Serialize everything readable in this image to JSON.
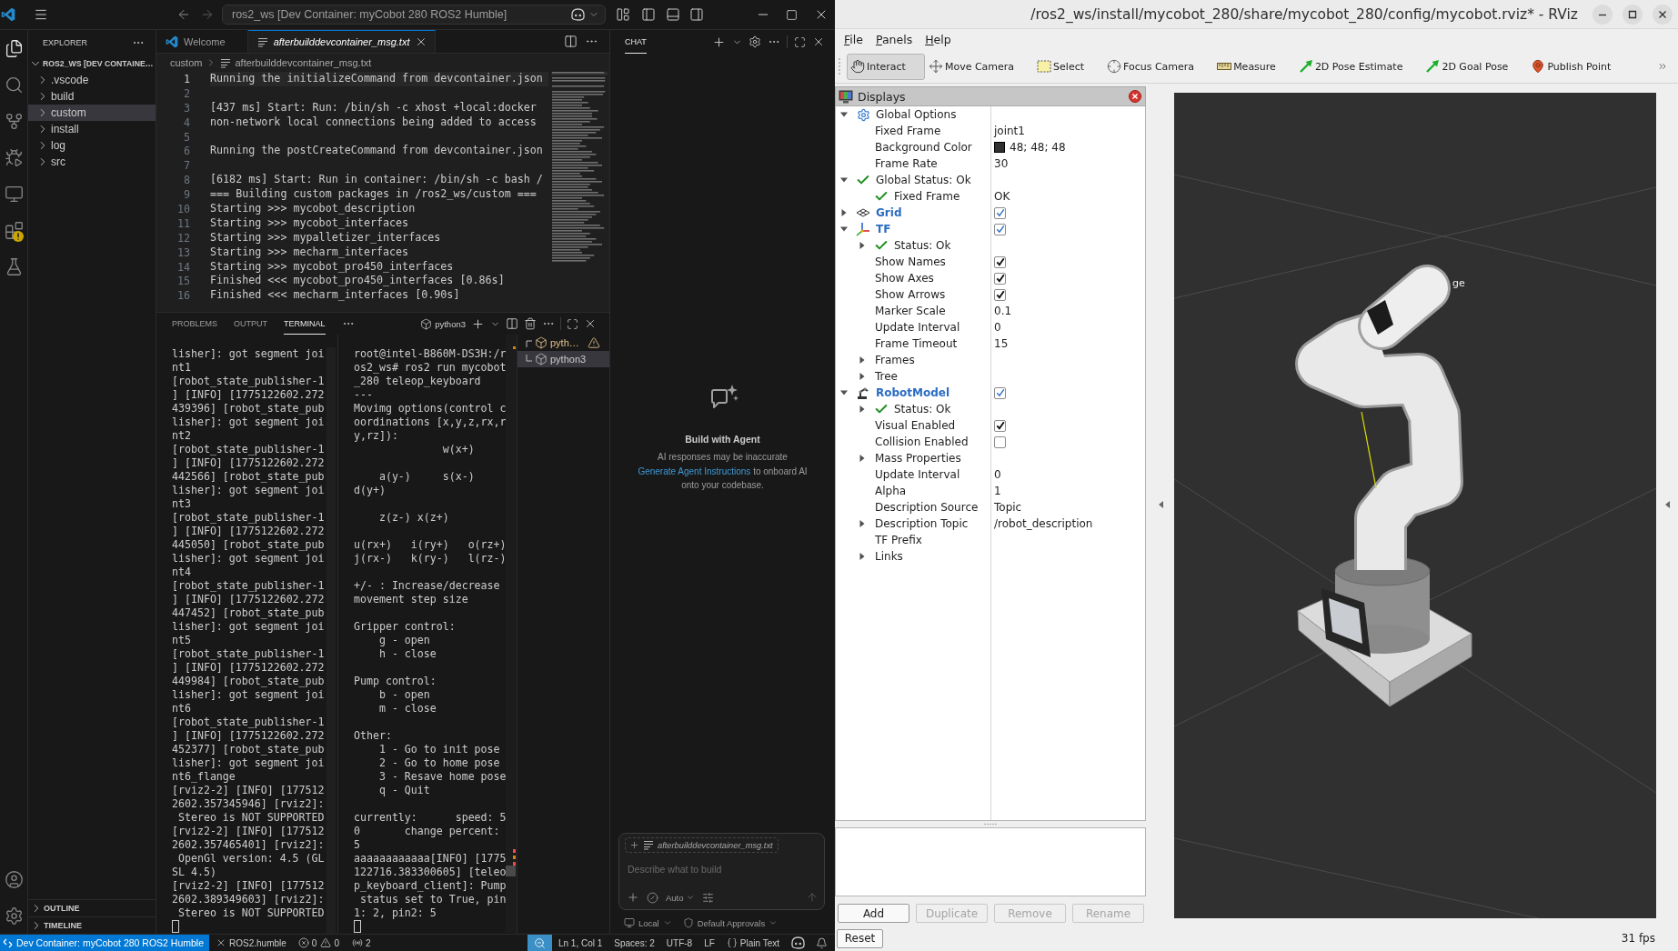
{
  "vscode": {
    "title_bar": {
      "command_center": "ros2_ws [Dev Container: myCobot 280 ROS2 Humble]"
    },
    "activity_bar": {
      "items": [
        {
          "kind": "explorer",
          "selected": true,
          "warning": false
        },
        {
          "kind": "search",
          "selected": false,
          "warning": false
        },
        {
          "kind": "source_control",
          "selected": false,
          "warning": false
        },
        {
          "kind": "run_debug",
          "selected": false,
          "warning": false
        },
        {
          "kind": "remote",
          "selected": false,
          "warning": false
        },
        {
          "kind": "extensions",
          "selected": false,
          "warning": true
        },
        {
          "kind": "testing",
          "selected": false,
          "warning": false
        }
      ],
      "bottom": [
        {
          "kind": "account"
        },
        {
          "kind": "manage"
        }
      ]
    },
    "explorer": {
      "title": "EXPLORER",
      "root": {
        "label": "ROS2_WS [DEV CONTAINE…",
        "expanded": true,
        "children": [
          {
            "label": ".vscode",
            "expanded": false,
            "selected": false
          },
          {
            "label": "build",
            "expanded": false,
            "selected": false
          },
          {
            "label": "custom",
            "expanded": false,
            "selected": true
          },
          {
            "label": "install",
            "expanded": false,
            "selected": false
          },
          {
            "label": "log",
            "expanded": false,
            "selected": false
          },
          {
            "label": "src",
            "expanded": false,
            "selected": false
          }
        ]
      },
      "sections": [
        {
          "label": "OUTLINE",
          "expanded": false
        },
        {
          "label": "TIMELINE",
          "expanded": false
        }
      ]
    },
    "editor": {
      "tabs": [
        {
          "kind": "welcome",
          "label": "Welcome",
          "selected": false,
          "preview": false
        },
        {
          "kind": "file",
          "label": "afterbuilddevcontainer_msg.txt",
          "selected": true,
          "preview": true
        }
      ],
      "breadcrumbs": [
        "custom",
        "afterbuilddevcontainer_msg.txt"
      ],
      "lines": [
        {
          "number": "1",
          "text": "Running the initializeCommand from devcontainer.json",
          "current": true
        },
        {
          "number": "2",
          "current": false
        },
        {
          "number": "3",
          "text": "[437 ms] Start: Run: /bin/sh -c xhost +local:docker",
          "current": false
        },
        {
          "number": "4",
          "text": "non-network local connections being added to access",
          "current": false
        },
        {
          "number": "5",
          "current": false
        },
        {
          "number": "6",
          "text": "Running the postCreateCommand from devcontainer.json",
          "current": false
        },
        {
          "number": "7",
          "current": false
        },
        {
          "number": "8",
          "text": "[6182 ms] Start: Run in container: /bin/sh -c bash /",
          "current": false
        },
        {
          "number": "9",
          "text": "=== Building custom packages in /ros2_ws/custom ===",
          "current": false
        },
        {
          "number": "10",
          "text": "Starting >>> mycobot_description",
          "current": false
        },
        {
          "number": "11",
          "text": "Starting >>> mycobot_interfaces",
          "current": false
        },
        {
          "number": "12",
          "text": "Starting >>> mypalletizer_interfaces",
          "current": false
        },
        {
          "number": "13",
          "text": "Starting >>> mecharm_interfaces",
          "current": false
        },
        {
          "number": "14",
          "text": "Starting >>> mycobot_pro450_interfaces",
          "current": false
        },
        {
          "number": "15",
          "text": "Finished <<< mycobot_pro450_interfaces [0.86s]",
          "current": false
        },
        {
          "number": "16",
          "text": "Finished <<< mecharm_interfaces [0.90s]",
          "current": false
        }
      ]
    },
    "panel": {
      "tabs": [
        {
          "label": "PROBLEMS",
          "selected": false
        },
        {
          "label": "OUTPUT",
          "selected": false
        },
        {
          "label": "TERMINAL",
          "selected": true
        }
      ],
      "active_terminal": "python3",
      "terminals": [
        {
          "text": "lisher]: got segment joi\nnt1\n[robot_state_publisher-1\n] [INFO] [1775122602.272\n439396] [robot_state_pub\nlisher]: got segment joi\nnt2\n[robot_state_publisher-1\n] [INFO] [1775122602.272\n442566] [robot_state_pub\nlisher]: got segment joi\nnt3\n[robot_state_publisher-1\n] [INFO] [1775122602.272\n445050] [robot_state_pub\nlisher]: got segment joi\nnt4\n[robot_state_publisher-1\n] [INFO] [1775122602.272\n447452] [robot_state_pub\nlisher]: got segment joi\nnt5\n[robot_state_publisher-1\n] [INFO] [1775122602.272\n449984] [robot_state_pub\nlisher]: got segment joi\nnt6\n[robot_state_publisher-1\n] [INFO] [1775122602.272\n452377] [robot_state_pub\nlisher]: got segment joi\nnt6_flange\n[rviz2-2] [INFO] [177512\n2602.357345946] [rviz2]:\n Stereo is NOT SUPPORTED\n[rviz2-2] [INFO] [177512\n2602.357465401] [rviz2]:\n OpenGl version: 4.5 (GL\nSL 4.5)\n[rviz2-2] [INFO] [177512\n2602.389349603] [rviz2]:\n Stereo is NOT SUPPORTED"
        },
        {
          "text": "root@intel-B860M-DS3H:/r\nos2_ws# ros2 run mycobot\n_280 teleop_keyboard\n---\nMovimg options(control c\noordinations [x,y,z,rx,r\ny,rz]):\n              w(x+)\n\n    a(y-)     s(x-)\nd(y+)\n\n    z(z-) x(z+)\n\nu(rx+)   i(ry+)   o(rz+)\nj(rx-)   k(ry-)   l(rz-)\n\n+/- : Increase/decrease\nmovement step size\n\nGripper control:\n    g - open\n    h - close\n\nPump control:\n    b - open\n    m - close\n\nOther:\n    1 - Go to init pose\n    2 - Go to home pose\n    3 - Resave home pose\n    q - Quit\n\ncurrently:      speed: 5\n0       change percent:\n5\naaaaaaaaaaaa[INFO] [1775\n122716.383300605] [teleo\np_keyboard_client]: Pump\n status set to True, pin\n1: 2, pin2: 5"
        }
      ],
      "terminal_list": [
        {
          "label": "pyth…",
          "selected": false,
          "warning": true
        },
        {
          "label": "python3",
          "selected": true,
          "warning": false
        }
      ]
    },
    "chat": {
      "title": "CHAT",
      "heading": "Build with Agent",
      "note": "AI responses may be inaccurate",
      "instructions": {
        "link": "Generate Agent Instructions",
        "text": "to onboard AI onto your codebase."
      },
      "input": {
        "attachment": "afterbuilddevcontainer_msg.txt",
        "placeholder": "Describe what to build",
        "mode": "Auto"
      },
      "footer": [
        {
          "kind": "location",
          "label": "Local"
        },
        {
          "kind": "approvals",
          "label": "Default Approvals"
        }
      ]
    },
    "status_bar": {
      "remote": "Dev Container: myCobot 280 ROS2 Humble",
      "left": [
        {
          "kind": "ros",
          "label": "ROS2.humble"
        },
        {
          "kind": "errors",
          "label": "0"
        },
        {
          "kind": "warnings",
          "label": "0"
        },
        {
          "kind": "ports",
          "label": "2"
        }
      ],
      "right": [
        {
          "kind": "zoom"
        },
        {
          "kind": "text",
          "label": "Ln 1, Col 1"
        },
        {
          "kind": "text",
          "label": "Spaces: 2"
        },
        {
          "kind": "text",
          "label": "UTF-8"
        },
        {
          "kind": "text",
          "label": "LF"
        },
        {
          "kind": "language",
          "label": "Plain Text"
        },
        {
          "kind": "copilot"
        },
        {
          "kind": "notifications"
        }
      ]
    }
  },
  "rviz": {
    "title": "/ros2_ws/install/mycobot_280/share/mycobot_280/config/mycobot.rviz* - RViz",
    "menu": [
      "File",
      "Panels",
      "Help"
    ],
    "tools": [
      {
        "kind": "interact",
        "label": "Interact",
        "selected": true
      },
      {
        "kind": "move_camera",
        "label": "Move Camera",
        "selected": false
      },
      {
        "kind": "select",
        "label": "Select",
        "selected": false
      },
      {
        "kind": "focus_camera",
        "label": "Focus Camera",
        "selected": false
      },
      {
        "kind": "measure",
        "label": "Measure",
        "selected": false
      },
      {
        "kind": "pose_estimate",
        "label": "2D Pose Estimate",
        "selected": false
      },
      {
        "kind": "goal_pose",
        "label": "2D Goal Pose",
        "selected": false
      },
      {
        "kind": "publish_point",
        "label": "Publish Point",
        "selected": false
      }
    ],
    "displays": {
      "title": "Displays",
      "tree": [
        {
          "kind": "group",
          "label": "Global Options",
          "expanded": true,
          "children": [
            {
              "kind": "property",
              "label": "Fixed Frame",
              "value": "joint1"
            },
            {
              "kind": "property",
              "label": "Background Color",
              "value": "48; 48; 48",
              "color": "#303030"
            },
            {
              "kind": "property",
              "label": "Frame Rate",
              "value": "30"
            }
          ]
        },
        {
          "kind": "status",
          "label": "Global Status: Ok",
          "expanded": true,
          "children": [
            {
              "kind": "status",
              "label": "Fixed Frame",
              "value": "OK"
            }
          ]
        },
        {
          "kind": "grid",
          "label": "Grid",
          "expanded": false,
          "checked": true
        },
        {
          "kind": "tf",
          "label": "TF",
          "expanded": true,
          "checked": true,
          "children": [
            {
              "kind": "status",
              "label": "Status: Ok",
              "expanded": false
            },
            {
              "kind": "property",
              "label": "Show Names",
              "checked": true
            },
            {
              "kind": "property",
              "label": "Show Axes",
              "checked": true
            },
            {
              "kind": "property",
              "label": "Show Arrows",
              "checked": true
            },
            {
              "kind": "property",
              "label": "Marker Scale",
              "value": "0.1"
            },
            {
              "kind": "property",
              "label": "Update Interval",
              "value": "0"
            },
            {
              "kind": "property",
              "label": "Frame Timeout",
              "value": "15"
            },
            {
              "kind": "property",
              "label": "Frames",
              "expanded": false
            },
            {
              "kind": "property",
              "label": "Tree",
              "expanded": false
            }
          ]
        },
        {
          "kind": "robotmodel",
          "label": "RobotModel",
          "expanded": true,
          "checked": true,
          "children": [
            {
              "kind": "status",
              "label": "Status: Ok",
              "expanded": false
            },
            {
              "kind": "property",
              "label": "Visual Enabled",
              "checked": true
            },
            {
              "kind": "property",
              "label": "Collision Enabled",
              "checked": false
            },
            {
              "kind": "property",
              "label": "Mass Properties",
              "expanded": false
            },
            {
              "kind": "property",
              "label": "Update Interval",
              "value": "0"
            },
            {
              "kind": "property",
              "label": "Alpha",
              "value": "1"
            },
            {
              "kind": "property",
              "label": "Description Source",
              "value": "Topic"
            },
            {
              "kind": "property",
              "label": "Description Topic",
              "expanded": false,
              "value": "/robot_description"
            },
            {
              "kind": "property",
              "label": "TF Prefix"
            },
            {
              "kind": "property",
              "label": "Links",
              "expanded": false
            }
          ]
        }
      ]
    },
    "buttons": [
      {
        "label": "Add",
        "disabled": false
      },
      {
        "label": "Duplicate",
        "disabled": true
      },
      {
        "label": "Remove",
        "disabled": true
      },
      {
        "label": "Rename",
        "disabled": true
      }
    ],
    "reset": "Reset",
    "fps": "31 fps",
    "scene": {
      "frame_label": "ge"
    }
  }
}
